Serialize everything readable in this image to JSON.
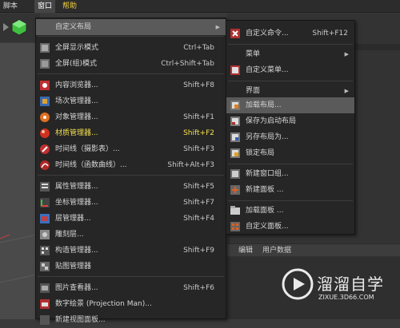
{
  "menubar": {
    "items": [
      "脚本",
      "窗口",
      "帮助"
    ]
  },
  "main_menu": {
    "items": [
      {
        "label": "自定义布局",
        "shortcut": "",
        "submenu": true
      },
      {
        "label": "全屏显示模式",
        "shortcut": "Ctrl+Tab"
      },
      {
        "label": "全屏(组)模式",
        "shortcut": "Ctrl+Shift+Tab"
      },
      {
        "label": "内容浏览器...",
        "shortcut": "Shift+F8"
      },
      {
        "label": "场次管理器...",
        "shortcut": ""
      },
      {
        "label": "对象管理器...",
        "shortcut": "Shift+F1"
      },
      {
        "label": "材质管理器...",
        "shortcut": "Shift+F2"
      },
      {
        "label": "时间线（摄影表）...",
        "shortcut": "Shift+F3"
      },
      {
        "label": "时间线（函数曲线）...",
        "shortcut": "Shift+Alt+F3"
      },
      {
        "label": "属性管理器...",
        "shortcut": "Shift+F5"
      },
      {
        "label": "坐标管理器...",
        "shortcut": "Shift+F7"
      },
      {
        "label": "层管理器...",
        "shortcut": "Shift+F4"
      },
      {
        "label": "雕刻层...",
        "shortcut": ""
      },
      {
        "label": "构造管理器...",
        "shortcut": "Shift+F9"
      },
      {
        "label": "贴图管理器",
        "shortcut": ""
      },
      {
        "label": "图片查看器...",
        "shortcut": "Shift+F6"
      },
      {
        "label": "数字绘景 (Projection Man)...",
        "shortcut": ""
      },
      {
        "label": "新建视图面板...",
        "shortcut": ""
      }
    ]
  },
  "sub_menu": {
    "items": [
      {
        "label": "自定义命令...",
        "shortcut": "Shift+F12"
      },
      {
        "label": "菜单",
        "submenu": true
      },
      {
        "label": "自定义菜单...",
        "shortcut": ""
      },
      {
        "label": "界面",
        "submenu": true
      },
      {
        "label": "加载布局...",
        "shortcut": ""
      },
      {
        "label": "保存为启动布局",
        "shortcut": ""
      },
      {
        "label": "另存布局为...",
        "shortcut": ""
      },
      {
        "label": "锁定布局",
        "shortcut": ""
      },
      {
        "label": "新建窗口组...",
        "shortcut": ""
      },
      {
        "label": "新建面板 ...",
        "shortcut": ""
      },
      {
        "label": "加载面板 ...",
        "shortcut": ""
      },
      {
        "label": "自定义面板...",
        "shortcut": ""
      }
    ]
  },
  "attributes_bar": {
    "items": [
      "编辑",
      "用户数据"
    ]
  },
  "watermark": {
    "title": "溜溜自学",
    "subtitle": "ZIXUE.3D66.COM"
  },
  "colors": {
    "highlight_yellow": "#f5e050",
    "menu_bg": "#262626",
    "hover_bg": "#5a5a5a"
  }
}
